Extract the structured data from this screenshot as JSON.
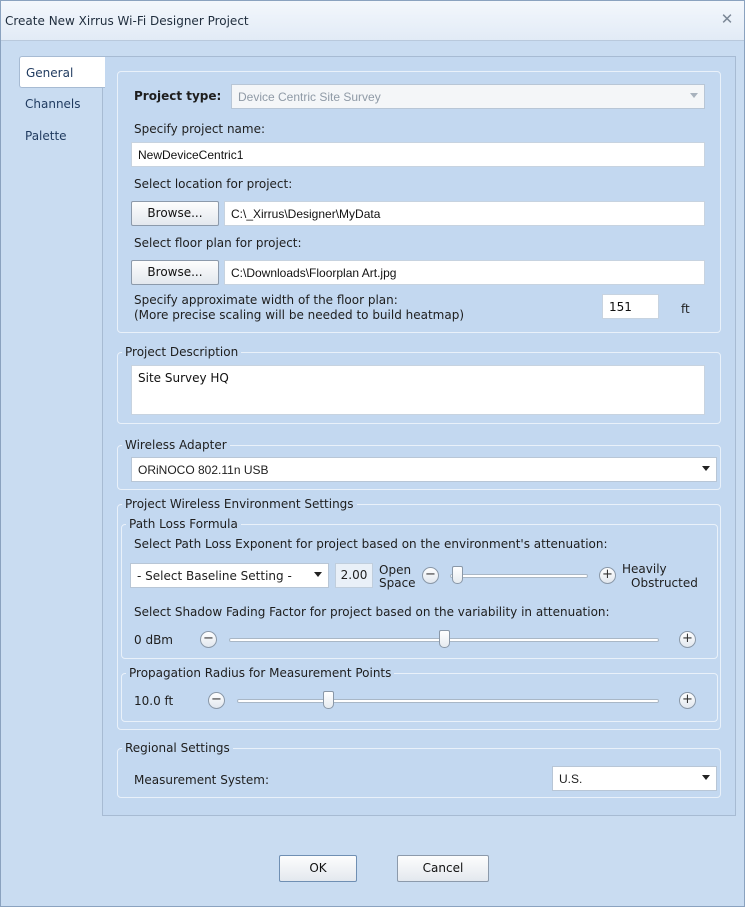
{
  "window": {
    "title": "Create New Xirrus Wi-Fi Designer Project",
    "close_glyph": "✕"
  },
  "tabs": [
    {
      "label": "General",
      "active": true
    },
    {
      "label": "Channels",
      "active": false
    },
    {
      "label": "Palette",
      "active": false
    }
  ],
  "project": {
    "type_label": "Project type:",
    "type_value": "Device Centric Site Survey",
    "name_label": "Specify project name:",
    "name_value": "NewDeviceCentric1",
    "location_label": "Select location for project:",
    "location_browse": "Browse...",
    "location_value": "C:\\_Xirrus\\Designer\\MyData",
    "floorplan_label": "Select floor plan for project:",
    "floorplan_browse": "Browse...",
    "floorplan_value": "C:\\Downloads\\Floorplan Art.jpg",
    "width_label_1": "Specify approximate width of the floor plan:",
    "width_label_2": "(More precise scaling will be needed to build heatmap)",
    "width_value": "151",
    "width_unit": "ft"
  },
  "description": {
    "group_title": "Project Description",
    "value": "Site Survey HQ"
  },
  "adapter": {
    "group_title": "Wireless Adapter",
    "value": "ORiNOCO 802.11n USB"
  },
  "environment": {
    "group_title": "Project Wireless Environment Settings",
    "path_loss": {
      "group_title": "Path Loss Formula",
      "exponent_label": "Select Path Loss Exponent for project based on the environment's attenuation:",
      "baseline_value": "- Select Baseline Setting -",
      "exponent_value": "2.00",
      "left_label_1": "Open",
      "left_label_2": "Space",
      "right_label_1": "Heavily",
      "right_label_2": "Obstructed",
      "exponent_slider_level": 0.0,
      "shadow_label": "Select Shadow Fading Factor for project based on the variability in attenuation:",
      "shadow_value": "0 dBm",
      "shadow_slider_level": 0.5
    },
    "propagation": {
      "group_title": "Propagation Radius for Measurement Points",
      "value": "10.0 ft",
      "slider_level": 0.21
    }
  },
  "regional": {
    "group_title": "Regional Settings",
    "measurement_label": "Measurement System:",
    "measurement_value": "U.S."
  },
  "footer": {
    "ok_label": "OK",
    "cancel_label": "Cancel"
  },
  "icons": {
    "minus": "minus-icon",
    "plus": "plus-icon",
    "dropdown": "chevron-down-icon"
  }
}
